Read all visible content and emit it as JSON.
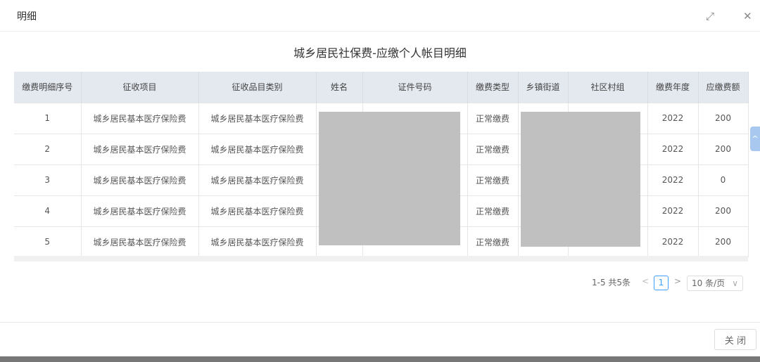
{
  "dialog": {
    "title": "明细",
    "expand_icon": "expand-icon",
    "close_icon": "close-icon"
  },
  "main_title": "城乡居民社保费-应缴个人帐目明细",
  "table": {
    "headers": [
      "缴费明细序号",
      "征收项目",
      "征收品目类别",
      "姓名",
      "证件号码",
      "缴费类型",
      "乡镇街道",
      "社区村组",
      "缴费年度",
      "应缴费额"
    ],
    "rows": [
      [
        "1",
        "城乡居民基本医疗保险费",
        "城乡居民基本医疗保险费",
        "",
        "",
        "正常缴费",
        "",
        "",
        "2022",
        "200"
      ],
      [
        "2",
        "城乡居民基本医疗保险费",
        "城乡居民基本医疗保险费",
        "",
        "",
        "正常缴费",
        "",
        "",
        "2022",
        "200"
      ],
      [
        "3",
        "城乡居民基本医疗保险费",
        "城乡居民基本医疗保险费",
        "",
        "",
        "正常缴费",
        "",
        "",
        "2022",
        "0"
      ],
      [
        "4",
        "城乡居民基本医疗保险费",
        "城乡居民基本医疗保险费",
        "",
        "",
        "正常缴费",
        "",
        "",
        "2022",
        "200"
      ],
      [
        "5",
        "城乡居民基本医疗保险费",
        "城乡居民基本医疗保险费",
        "",
        "",
        "正常缴费",
        "",
        "",
        "2022",
        "200"
      ]
    ]
  },
  "pagination": {
    "summary": "1-5 共5条",
    "prev": "<",
    "current_page": "1",
    "next": ">",
    "page_size": "10 条/页"
  },
  "footer": {
    "close_label": "关 闭"
  }
}
